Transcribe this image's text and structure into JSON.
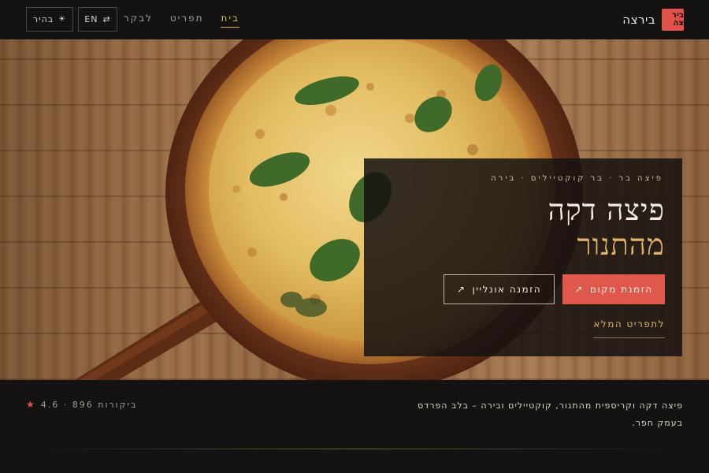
{
  "header": {
    "brand_logo_text": "ביר צה",
    "brand_name": "בירצה",
    "nav": [
      {
        "label": "בית",
        "active": true
      },
      {
        "label": "תפריט",
        "active": false
      },
      {
        "label": "לבקר",
        "active": false
      }
    ],
    "lang_button": {
      "label": "EN",
      "icon": "swap-arrows-icon"
    },
    "theme_button": {
      "label": "בהיר",
      "icon": "sun-icon"
    }
  },
  "hero": {
    "tagline": "פיצה בר · בר קוקטיילים · בירה",
    "title_line1": "פיצה דקה",
    "title_line2": "מהתנור",
    "primary_button": {
      "label": "הזמנת מקום",
      "icon": "arrow-up-right-icon"
    },
    "secondary_button": {
      "label": "הזמנה אונליין",
      "icon": "arrow-up-right-icon"
    },
    "menu_link": "לתפריט המלא"
  },
  "footer": {
    "description": "פיצה דקה וקריספית מהתנור, קוקטיילים ובירה – בלב הפרדס בעמק חפר.",
    "rating": {
      "star_icon": "star-icon",
      "text": "4.6 · 896 ביקורות"
    }
  },
  "colors": {
    "accent": "#e0574c",
    "gold": "#d9b46c",
    "background": "#151312"
  }
}
